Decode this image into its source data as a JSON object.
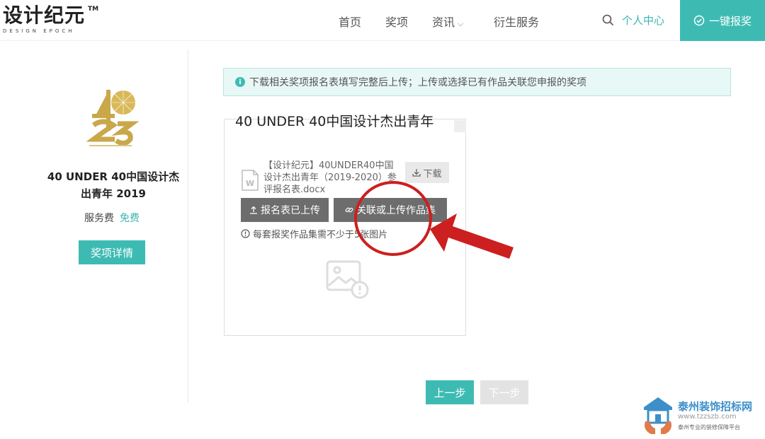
{
  "logo": {
    "main": "设计纪元",
    "tm": "TM",
    "sub": "DESIGN EPOCH"
  },
  "nav": {
    "home": "首页",
    "awards": "奖项",
    "news": "资讯",
    "services": "衍生服务",
    "personal": "个人中心",
    "enroll": "一键报奖"
  },
  "award": {
    "title": "40 UNDER 40中国设计杰出青年 2019",
    "fee_label": "服务费",
    "fee_value": "免费",
    "detail_button": "奖项详情"
  },
  "notice": "下载相关奖项报名表填写完整后上传；上传或选择已有作品关联您申报的奖项",
  "section": {
    "title": "40 UNDER 40中国设计杰出青年"
  },
  "card": {
    "file_name": "【设计纪元】40UNDER40中国设计杰出青年（2019-2020）参评报名表.docx",
    "download_label": "下载",
    "form_uploaded_label": "报名表已上传",
    "link_upload_label": "关联或上传作品集",
    "tip": "每套报奖作品集需不少于5张图片"
  },
  "steps": {
    "prev": "上一步",
    "next": "下一步"
  },
  "watermark": {
    "title": "泰州装饰招标网",
    "url": "www.tzzszb.com",
    "slogan": "泰州专业的装修保障平台"
  },
  "colors": {
    "accent": "#3dbbb3",
    "annotation": "#cc1f1f",
    "button_dark": "#6d6d6d"
  },
  "icons": {
    "search": "search-icon",
    "enroll": "check-circle-icon",
    "info": "info-icon",
    "word": "word-file-icon",
    "download": "download-icon",
    "upload": "upload-icon",
    "link": "link-icon",
    "tip": "alert-circle-icon",
    "image": "image-placeholder-icon"
  }
}
